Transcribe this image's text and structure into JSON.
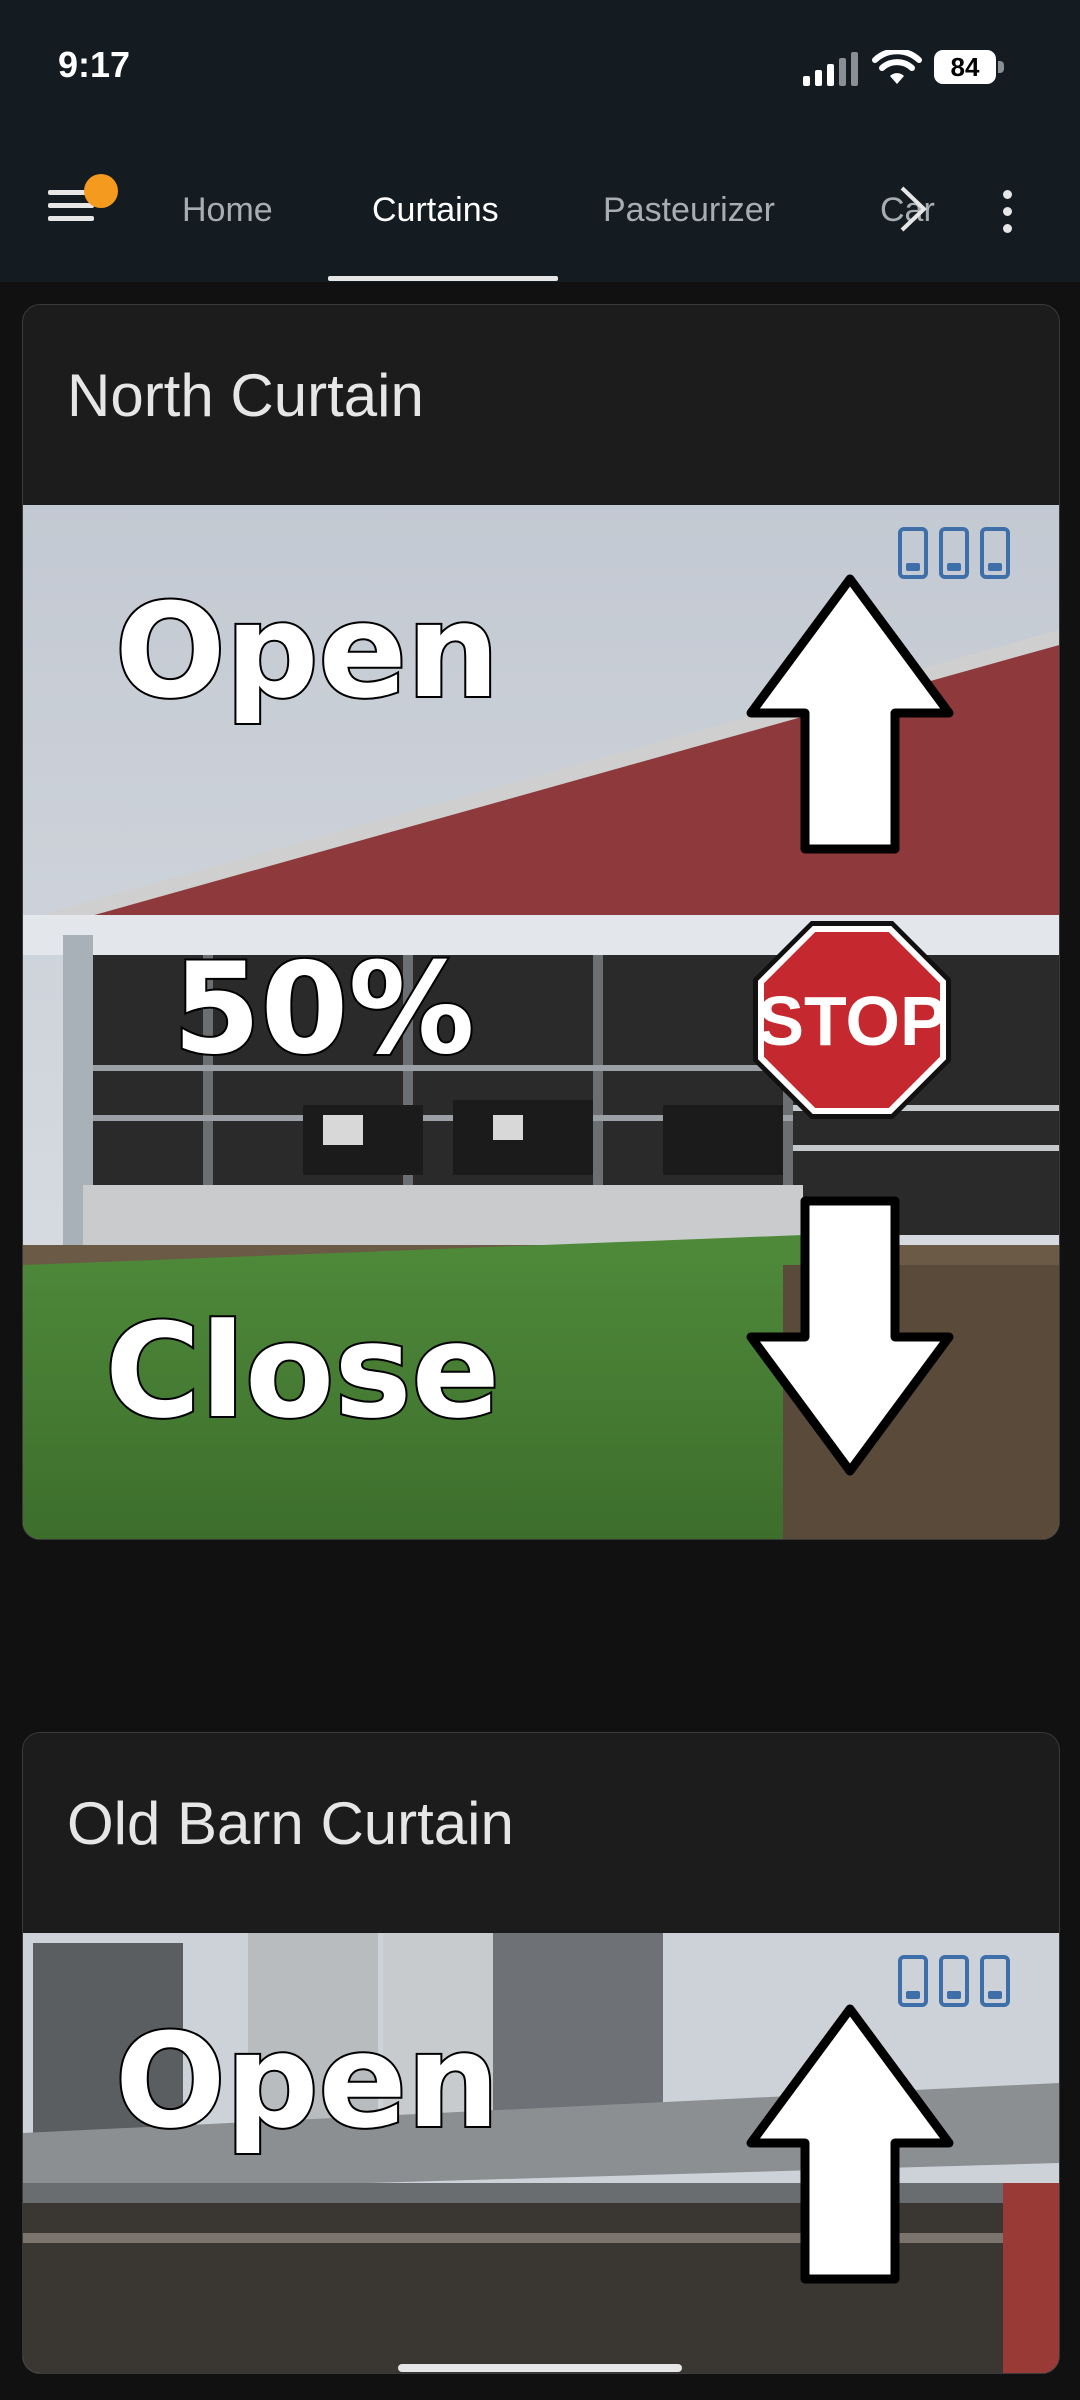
{
  "status_bar": {
    "time": "9:17",
    "battery": "84"
  },
  "tabs": [
    {
      "label": "Home"
    },
    {
      "label": "Curtains",
      "active": true
    },
    {
      "label": "Pasteurizer"
    },
    {
      "label": "Car"
    }
  ],
  "cards": [
    {
      "title": "North Curtain",
      "open_label": "Open",
      "percent": "50%",
      "stop_label": "STOP",
      "close_label": "Close"
    },
    {
      "title": "Old Barn Curtain",
      "open_label": "Open"
    }
  ],
  "icons": {
    "menu": "hamburger-menu-icon",
    "notification": "notification-dot",
    "tabs_scroll": "chevron-right-icon",
    "more": "more-vertical-icon",
    "bins": "storage-bin-icon"
  },
  "colors": {
    "accent_dot": "#f39a1f",
    "stop_red": "#c5282f",
    "bin_blue": "#3f6fa8"
  }
}
